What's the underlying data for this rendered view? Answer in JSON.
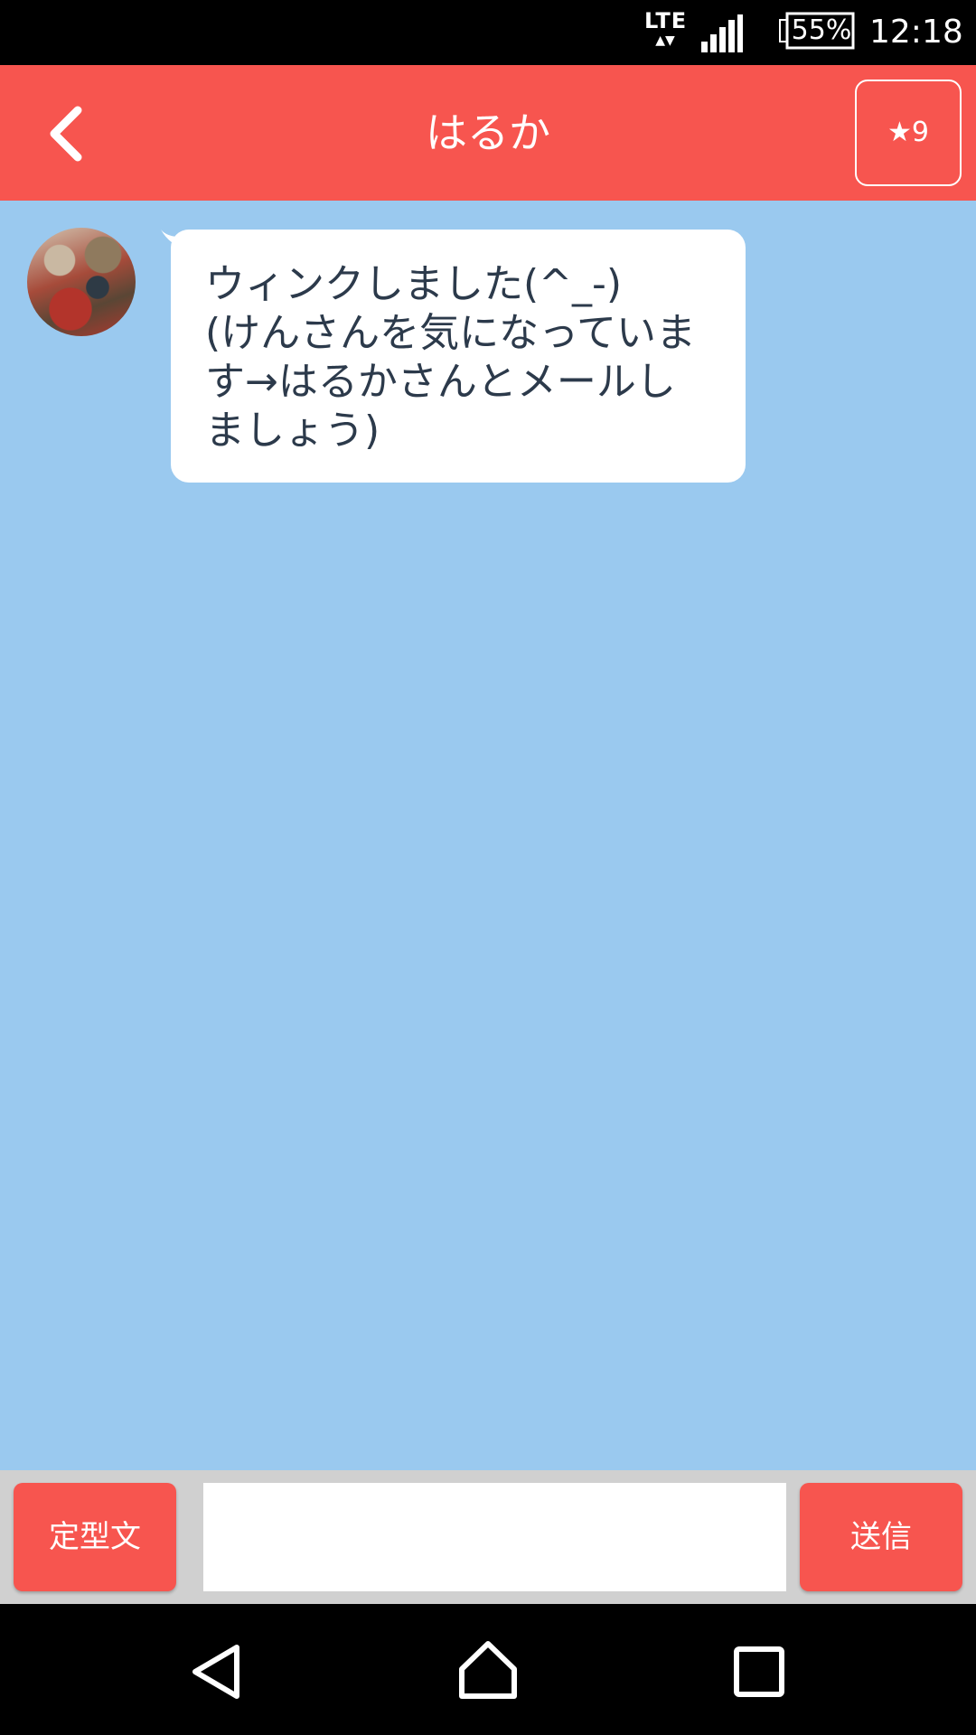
{
  "status_bar": {
    "network": "LTE",
    "network_arrows": "▲▼",
    "battery": "55%",
    "time": "12:18",
    "icons": [
      "lte-icon",
      "signal-icon",
      "battery-icon"
    ]
  },
  "header": {
    "back_icon": "chevron-left-icon",
    "title": "はるか",
    "favorite_label": "★9"
  },
  "chat": {
    "messages": [
      {
        "sender": "はるか",
        "text": "ウィンクしました(^_-)\n(けんさんを気になっていま\nす→はるかさんとメールし\nましょう)"
      }
    ]
  },
  "input_bar": {
    "template_label": "定型文",
    "input_value": "",
    "send_label": "送信"
  },
  "nav_bar": {
    "icons": [
      "back-triangle-icon",
      "home-icon",
      "recents-icon"
    ]
  },
  "colors": {
    "accent": "#f7554f",
    "chat_background": "#9ac9ef",
    "bubble": "#ffffff",
    "text": "#2c3a4b"
  }
}
